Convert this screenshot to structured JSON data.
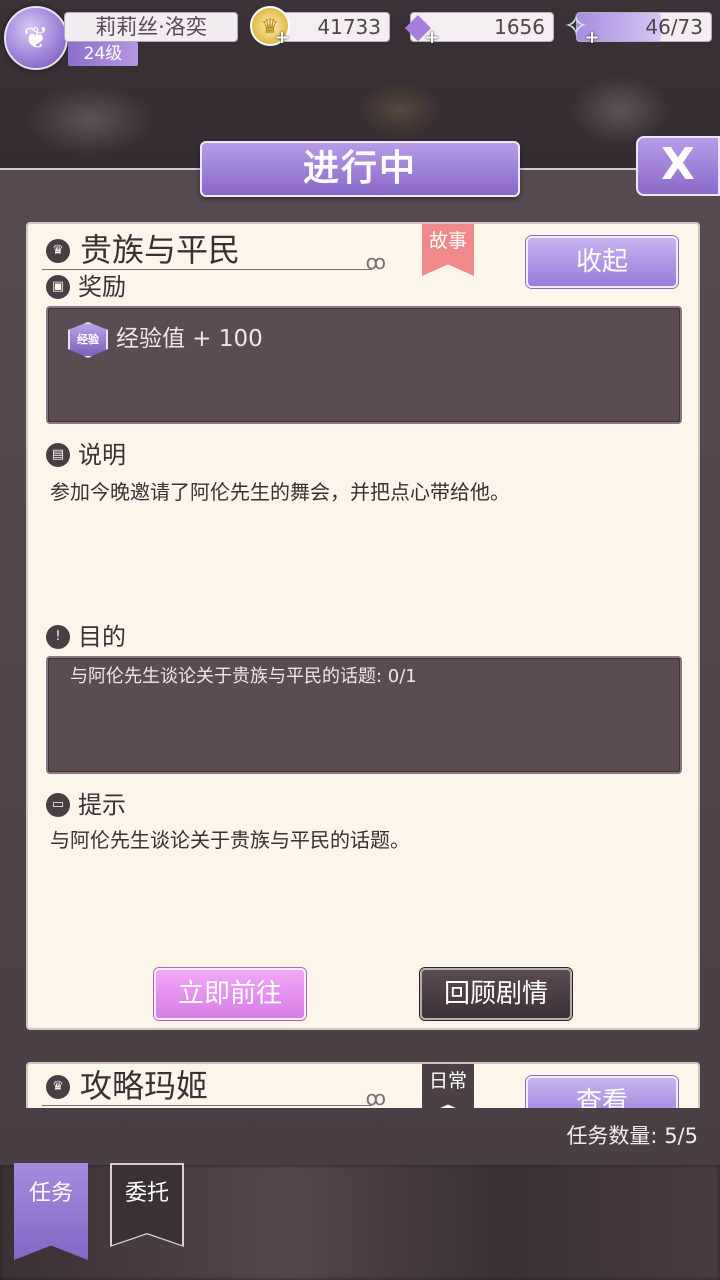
{
  "player": {
    "name": "莉莉丝·洛奕",
    "level": "24级",
    "gold": "41733",
    "diamonds": "1656",
    "stamina": "46/73",
    "stamina_fraction": 0.63
  },
  "panel": {
    "title": "进行中",
    "close_label": "X"
  },
  "quest": {
    "title": "贵族与平民",
    "tag": "故事",
    "collapse_label": "收起",
    "reward_header": "奖励",
    "reward_badge": "经验",
    "reward_text": "经验值 + 100",
    "desc_header": "说明",
    "desc_text": "参加今晚邀请了阿伦先生的舞会，并把点心带给他。",
    "goal_header": "目的",
    "goal_text": "与阿伦先生谈论关于贵族与平民的话题: 0/1",
    "hint_header": "提示",
    "hint_text": "与阿伦先生谈论关于贵族与平民的话题。",
    "go_label": "立即前往",
    "review_label": "回顾剧情"
  },
  "quest2": {
    "title": "攻略玛姬",
    "tag": "日常",
    "view_label": "查看"
  },
  "footer": {
    "task_count": "任务数量:  5/5"
  },
  "tabs": [
    {
      "label": "任务",
      "active": true
    },
    {
      "label": "委托",
      "active": false
    }
  ],
  "colors": {
    "accent_purple": "#9c7bd9",
    "card_bg": "#fbf5ea",
    "dark_box": "#5d4b52",
    "tag_story": "#f08a8a",
    "pink_button": "#d77de8"
  },
  "icons": [
    "wings-icon",
    "crown-coin-icon",
    "diamond-icon",
    "glass-slipper-icon",
    "crown-icon",
    "gift-icon",
    "book-icon",
    "exclamation-icon",
    "note-icon",
    "close-icon"
  ]
}
